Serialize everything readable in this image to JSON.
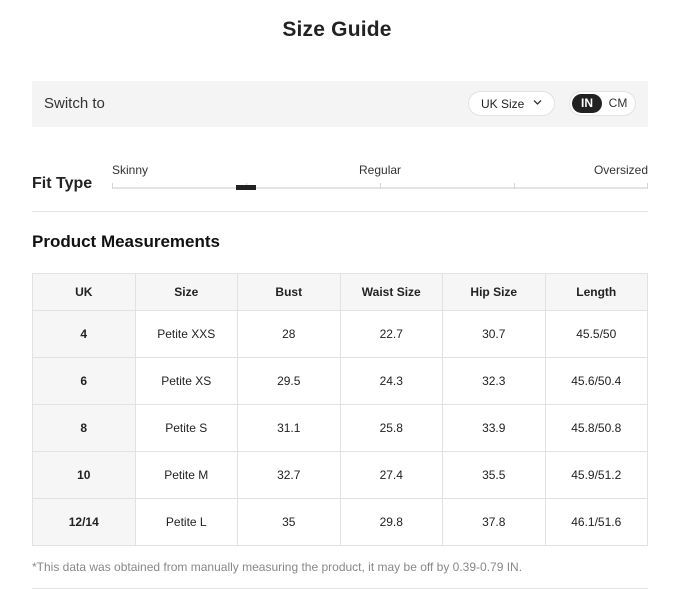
{
  "title": "Size Guide",
  "switch": {
    "label": "Switch to",
    "size_select": "UK Size",
    "unit_in": "IN",
    "unit_cm": "CM",
    "selected_unit": "IN"
  },
  "fit": {
    "label": "Fit Type",
    "options": [
      "Skinny",
      "Regular",
      "Oversized"
    ],
    "selected_level": 0.25
  },
  "measurements": {
    "title": "Product Measurements",
    "headers": [
      "UK",
      "Size",
      "Bust",
      "Waist Size",
      "Hip Size",
      "Length"
    ],
    "rows": [
      [
        "4",
        "Petite XXS",
        "28",
        "22.7",
        "30.7",
        "45.5/50"
      ],
      [
        "6",
        "Petite XS",
        "29.5",
        "24.3",
        "32.3",
        "45.6/50.4"
      ],
      [
        "8",
        "Petite S",
        "31.1",
        "25.8",
        "33.9",
        "45.8/50.8"
      ],
      [
        "10",
        "Petite M",
        "32.7",
        "27.4",
        "35.5",
        "45.9/51.2"
      ],
      [
        "12/14",
        "Petite L",
        "35",
        "29.8",
        "37.8",
        "46.1/51.6"
      ]
    ]
  },
  "note": "*This data was obtained from manually measuring the product, it may be off by 0.39-0.79 IN.",
  "colors": {
    "accent": "#222222",
    "panel": "#f4f4f4",
    "border": "#e2e2e2",
    "muted": "#888888"
  }
}
